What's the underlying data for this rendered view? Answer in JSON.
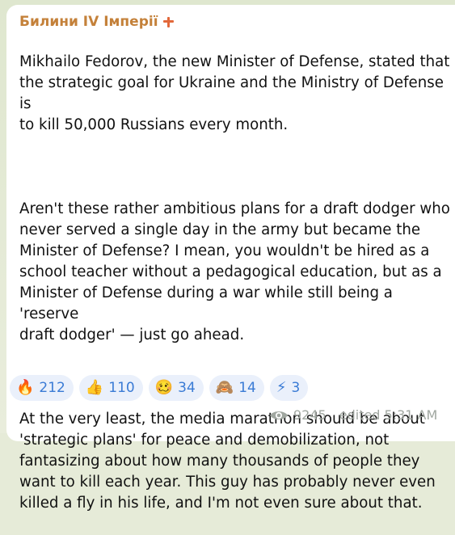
{
  "message": {
    "channel_name": "Билини IV Імперії",
    "paragraphs": [
      "Mikhailo Fedorov, the new Minister of Defense, stated that\nthe strategic goal for Ukraine and the Ministry of Defense is\nto kill 50,000 Russians every month.",
      "Aren't these rather ambitious plans for a draft dodger who\nnever served a single day in the army but became the\nMinister of Defense? I mean, you wouldn't be hired as a\nschool teacher without a pedagogical education, but as a\nMinister of Defense during a war while still being a 'reserve\ndraft dodger' — just go ahead.",
      "At the very least, the media marathon should be about\n'strategic plans' for peace and demobilization, not\nfantasizing about how many thousands of people they\nwant to kill each year. This guy has probably never even\nkilled a fly in his life, and I'm not even sure about that."
    ]
  },
  "reactions": [
    {
      "emoji": "🔥",
      "icon": "fire-icon",
      "count": "212"
    },
    {
      "emoji": "👍",
      "icon": "thumbs-up-icon",
      "count": "110"
    },
    {
      "emoji": "🥴",
      "icon": "woozy-face-icon",
      "count": "34"
    },
    {
      "emoji": "🙈",
      "icon": "see-no-evil-monkey-icon",
      "count": "14"
    },
    {
      "emoji": "⚡",
      "icon": "lightning-icon",
      "count": "3"
    }
  ],
  "meta": {
    "views": "9245",
    "edited_time": "edited 5:31 AM"
  },
  "colors": {
    "channel_name": "#c4813a",
    "reaction_bg": "#eaf0fb",
    "reaction_text": "#3a7bd5",
    "meta_text": "#a0a7a0"
  }
}
